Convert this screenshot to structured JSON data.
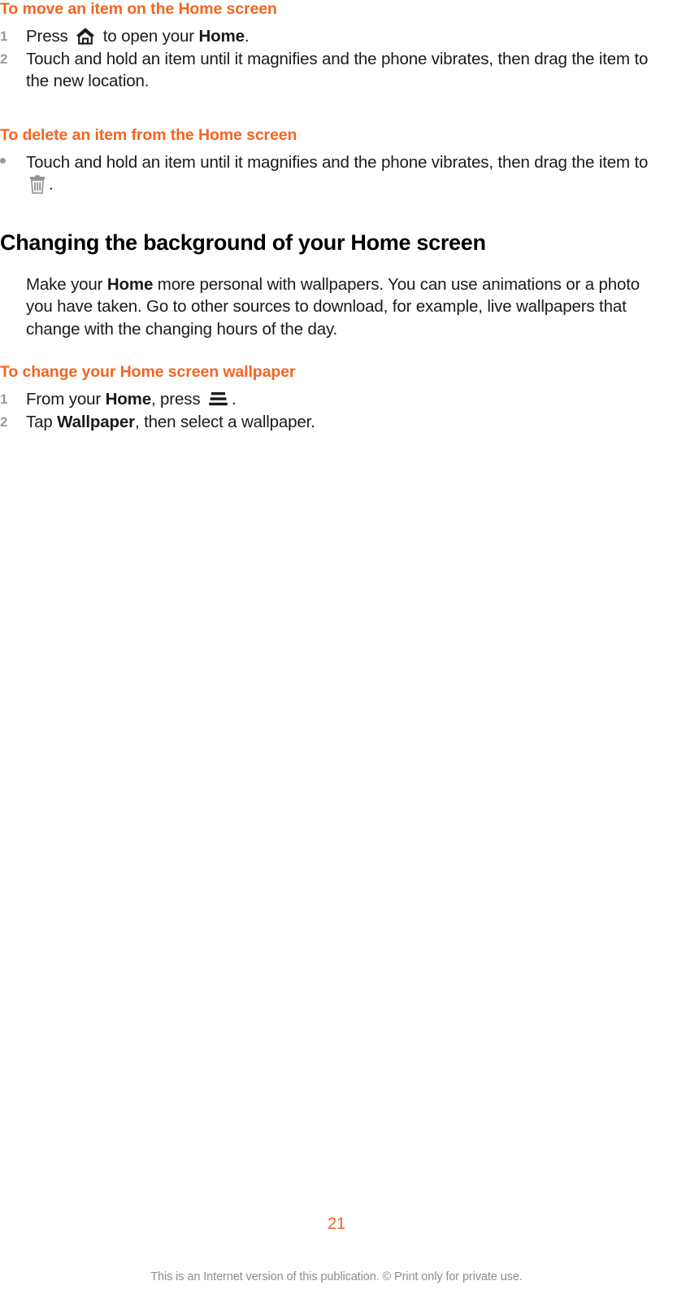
{
  "document": {
    "page_number": "21",
    "footer_note": "This is an Internet version of this publication. © Print only for private use.",
    "accent_color": "#F26522",
    "marker_color": "#9A9A9A",
    "body_color": "#1A1A1A"
  },
  "sections": [
    {
      "heading": "To move an item on the Home screen",
      "heading_style": "orange-sub",
      "items": [
        {
          "marker": "1",
          "text_before_icon": "Press ",
          "icon": "home-icon",
          "text_after_icon": " to open your ",
          "bold_term": "Home",
          "text_end": "."
        },
        {
          "marker": "2",
          "text": "Touch and hold an item until it magnifies and the phone vibrates, then drag the item to the new location."
        }
      ]
    },
    {
      "heading": "To delete an item from the Home screen",
      "heading_style": "orange-sub",
      "items": [
        {
          "marker": "bullet",
          "text_before_icon": "Touch and hold an item until it magnifies and the phone vibrates, then drag the item to ",
          "icon": "trash-icon",
          "text_end": "."
        }
      ]
    },
    {
      "heading": "Changing the background of your Home screen",
      "heading_style": "black-main",
      "paragraph_parts": {
        "p1": "Make your ",
        "bold_term": "Home",
        "p2": " more personal with wallpapers. You can use animations or a photo you have taken. Go to other sources to download, for example, live wallpapers that change with the changing hours of the day."
      }
    },
    {
      "heading": "To change your Home screen wallpaper",
      "heading_style": "orange-sub",
      "items": [
        {
          "marker": "1",
          "text_before_icon": "From your ",
          "bold_term": "Home",
          "text_mid": ", press ",
          "icon": "menu-icon",
          "text_end": "."
        },
        {
          "marker": "2",
          "text_before_bold": "Tap ",
          "bold_term": "Wallpaper",
          "text_end": ", then select a wallpaper."
        }
      ]
    }
  ]
}
